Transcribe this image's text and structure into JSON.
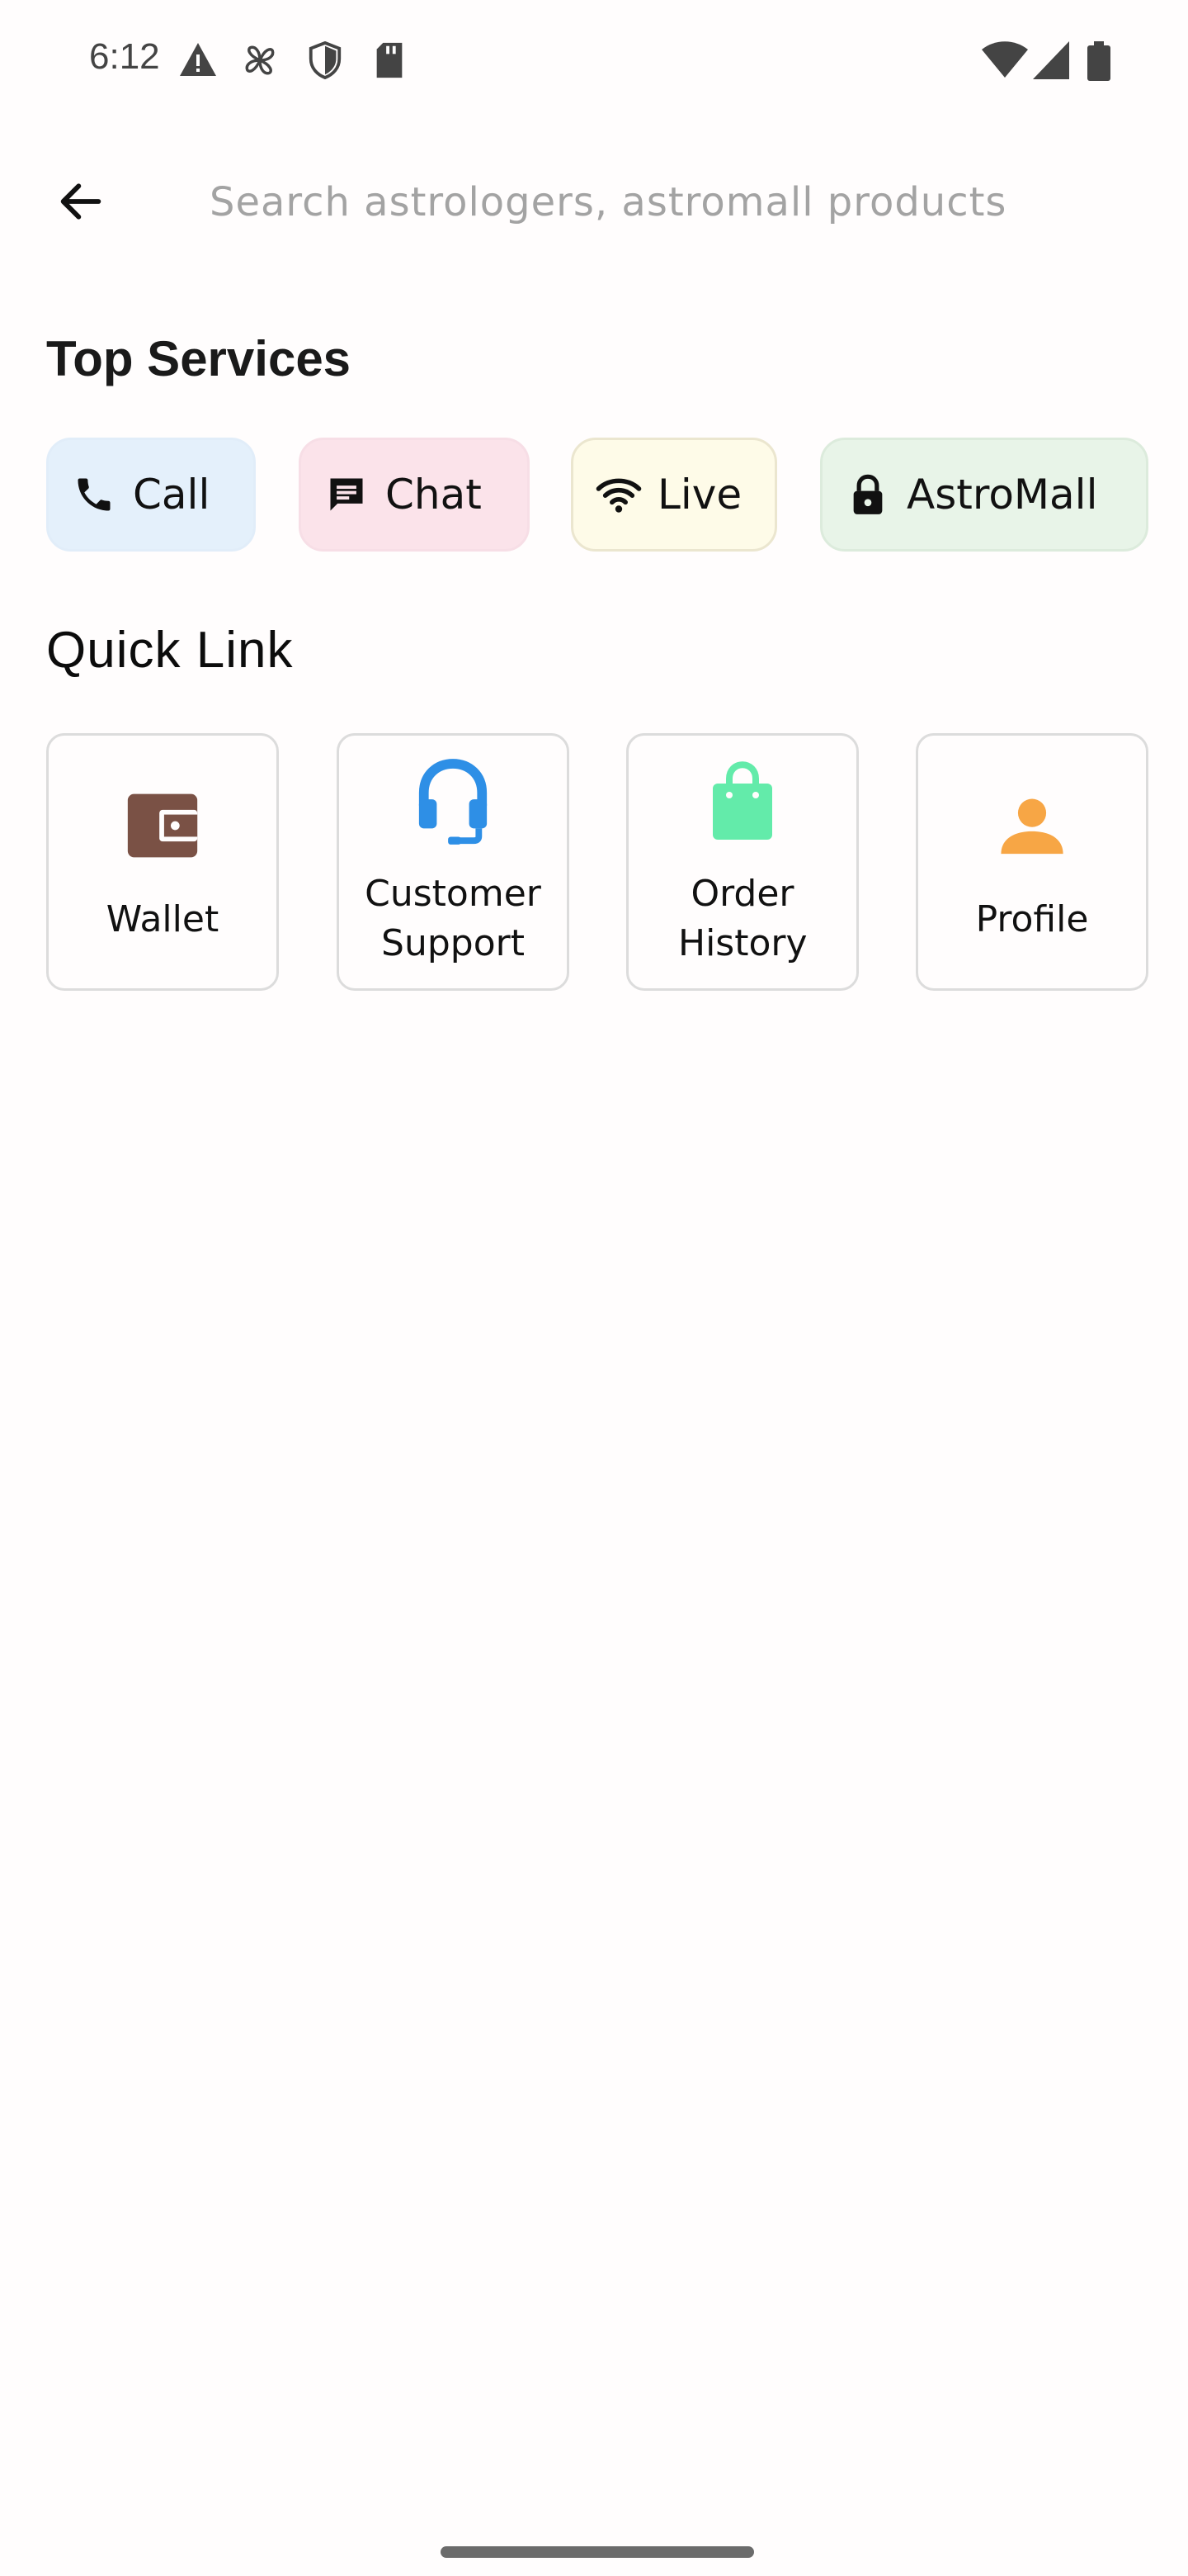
{
  "status_bar": {
    "time": "6:12",
    "left_icons": [
      "warning-icon",
      "fan-icon",
      "shield-icon",
      "sd-card-icon"
    ],
    "right_icons": [
      "wifi-icon",
      "cell-signal-icon",
      "battery-icon"
    ]
  },
  "search": {
    "placeholder": "Search astrologers, astromall products",
    "value": ""
  },
  "top_services": {
    "title": "Top Services",
    "items": [
      {
        "label": "Call",
        "icon": "phone-icon",
        "bg": "#e4f0fb"
      },
      {
        "label": "Chat",
        "icon": "chat-icon",
        "bg": "#fbe3ea"
      },
      {
        "label": "Live",
        "icon": "wifi-icon",
        "bg": "#fefbe8"
      },
      {
        "label": "AstroMall",
        "icon": "lock-icon",
        "bg": "#e8f4e8"
      }
    ]
  },
  "quick_link": {
    "title": "Quick Link",
    "items": [
      {
        "label": "Wallet",
        "icon": "wallet-icon",
        "color": "#7a5145"
      },
      {
        "label": "Customer Support",
        "icon": "headset-icon",
        "color": "#2e8fe6"
      },
      {
        "label": "Order History",
        "icon": "shopping-bag-icon",
        "color": "#63ebaa"
      },
      {
        "label": "Profile",
        "icon": "person-icon",
        "color": "#f7a645"
      }
    ]
  }
}
